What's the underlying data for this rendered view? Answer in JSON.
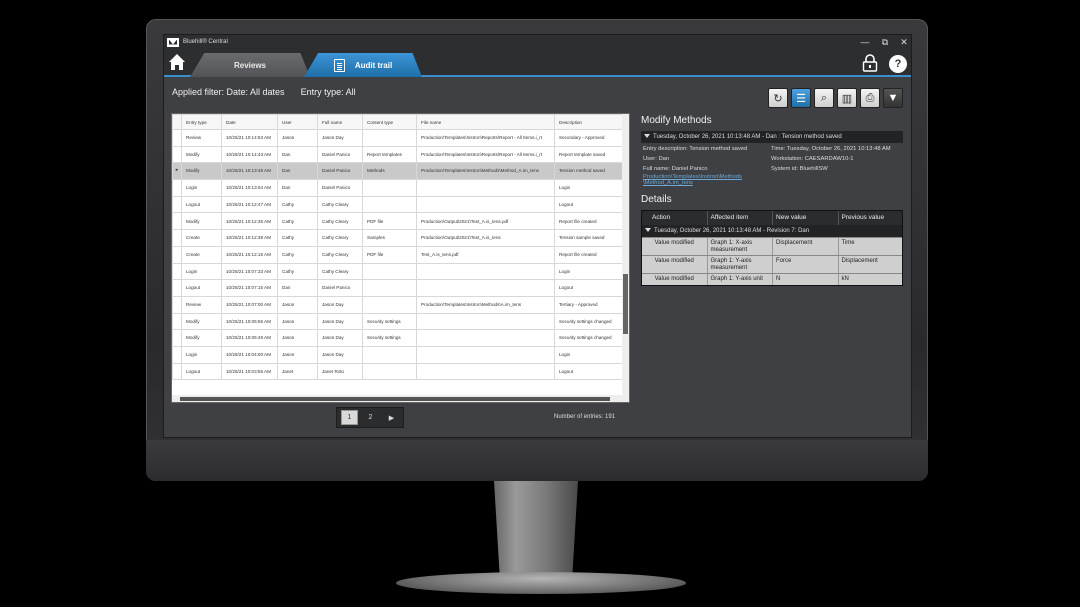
{
  "app": {
    "title": "Bluehill® Central"
  },
  "window": {
    "minimize": "—",
    "maximize": "⧉",
    "close": "✕"
  },
  "nav": {
    "tabs": [
      {
        "label": "Reviews"
      },
      {
        "label": "Audit trail"
      }
    ],
    "help_label": "?"
  },
  "filter": {
    "applied": "Applied filter: Date: All dates",
    "entry_type": "Entry type: All"
  },
  "toolbar": {
    "icons": [
      "refresh-icon",
      "list-icon",
      "search-icon",
      "export-icon",
      "print-icon",
      "filter-icon"
    ]
  },
  "table": {
    "columns": [
      "Entry type",
      "Date",
      "User",
      "Full name",
      "Content type",
      "File name",
      "Description"
    ],
    "rows": [
      [
        "Review",
        "10/25/21 10:14:53 AM",
        "Jason",
        "Jason Day",
        "",
        "Production\\Templates\\Instron\\Reports\\Report - All Items.i_rt",
        "Secondary - Approved"
      ],
      [
        "Modify",
        "10/25/21 10:14:43 AM",
        "Dan",
        "Daniel Panico",
        "Report templates",
        "Production\\Templates\\Instron\\Reports\\Report - All Items.i_rt",
        "Report template saved"
      ],
      [
        "Modify",
        "10/25/21 10:13:48 AM",
        "Dan",
        "Daniel Panico",
        "Methods",
        "Production\\Templates\\Instron\\Methods\\Method_A.im_tens",
        "Tension method saved"
      ],
      [
        "Login",
        "10/25/21 10:13:04 AM",
        "Dan",
        "Daniel Panico",
        "",
        "",
        "Login"
      ],
      [
        "Logout",
        "10/25/21 10:12:47 AM",
        "Cathy",
        "Cathy Cleary",
        "",
        "",
        "Logout"
      ],
      [
        "Modify",
        "10/25/21 10:12:35 AM",
        "Cathy",
        "Cathy Cleary",
        "PDF file",
        "Production\\Output\\2021\\Test_A.is_tens.pdf",
        "Report file created"
      ],
      [
        "Create",
        "10/25/21 10:12:38 AM",
        "Cathy",
        "Cathy Cleary",
        "Samples",
        "Production\\Output\\2021\\Test_A.is_tens",
        "Tension sample saved"
      ],
      [
        "Create",
        "10/25/21 10:12:15 AM",
        "Cathy",
        "Cathy Cleary",
        "PDF file",
        "Test_A.is_tens.pdf",
        "Report file created"
      ],
      [
        "Login",
        "10/25/21 10:07:33 AM",
        "Cathy",
        "Cathy Cleary",
        "",
        "",
        "Login"
      ],
      [
        "Logout",
        "10/25/21 10:07:15 AM",
        "Dan",
        "Daniel Panico",
        "",
        "",
        "Logout"
      ],
      [
        "Review",
        "10/25/21 10:07:00 AM",
        "Jason",
        "Jason Day",
        "",
        "Production\\Templates\\Instron\\Methods\\A.im_tens",
        "Tertiary - Approved"
      ],
      [
        "Modify",
        "10/25/21 10:05:56 AM",
        "Jason",
        "Jason Day",
        "Security settings",
        "",
        "Security settings changed"
      ],
      [
        "Modify",
        "10/25/21 10:05:48 AM",
        "Jason",
        "Jason Day",
        "Security settings",
        "",
        "Security settings changed"
      ],
      [
        "Login",
        "10/25/21 10:04:00 AM",
        "Jason",
        "Jason Day",
        "",
        "",
        "Login"
      ],
      [
        "Logout",
        "10/25/21 10:03:55 AM",
        "Janet",
        "Janet Rolo",
        "",
        "",
        "Logout"
      ]
    ],
    "selected_row": 2,
    "selected_marker": "▸"
  },
  "pager": {
    "pages": [
      "1",
      "2"
    ],
    "current": "1",
    "next": "▶"
  },
  "entries_count": "Number of entries: 191",
  "right_panel": {
    "title": "Modify Methods",
    "entry_header": "Tuesday, October 26, 2021 10:13:48 AM - Dan : Tension method saved",
    "entry_description": "Entry description: Tension method saved",
    "user": "User: Dan",
    "full_name": "Full name: Daniel Panico",
    "file_link": "Production\\Templates\\Instron\\Methods \\Method_A.im_tens",
    "time": "Time: Tuesday, October 26, 2021 10:13:48 AM",
    "workstation": "Workstation: CAESARDAW10-1",
    "system_id": "System id: BluehillSW",
    "details_title": "Details",
    "details_columns": [
      "Action",
      "Affected item",
      "New value",
      "Previous value"
    ],
    "details_group": "Tuesday, October 26, 2021 10:13:48 AM - Revision 7: Dan",
    "details_rows": [
      [
        "Value modified",
        "Graph 1: X-axis measurement",
        "Displacement",
        "Time"
      ],
      [
        "Value modified",
        "Graph 1: Y-axis measurement",
        "Force",
        "Displacement"
      ],
      [
        "Value modified",
        "Graph 1: Y-axis unit",
        "N",
        "kN"
      ]
    ]
  }
}
